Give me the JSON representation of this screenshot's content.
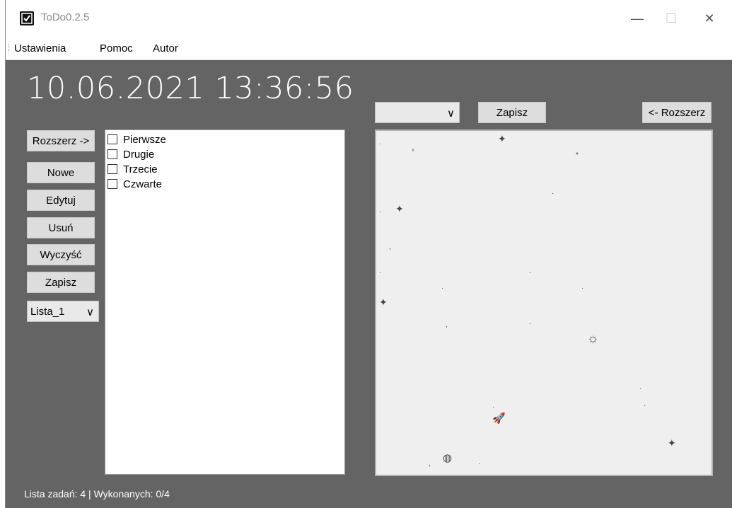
{
  "window": {
    "title": "ToDo0.2.5",
    "minimize_glyph": "—",
    "maximize_glyph": "☐",
    "close_glyph": "✕"
  },
  "menu": [
    "Ustawienia",
    "Pomoc",
    "Autor"
  ],
  "clock": "10.06.2021 13:36:56",
  "left_buttons": {
    "expand": "Rozszerz ->",
    "new": "Nowe",
    "edit": "Edytuj",
    "delete": "Usuń",
    "clear": "Wyczyść",
    "save": "Zapisz"
  },
  "list_select": {
    "value": "Lista_1",
    "arrow": "∨"
  },
  "tasks": [
    {
      "label": "Pierwsze",
      "done": false
    },
    {
      "label": "Drugie",
      "done": false
    },
    {
      "label": "Trzecie",
      "done": false
    },
    {
      "label": "Czwarte",
      "done": false
    }
  ],
  "right_panel": {
    "select_value": "",
    "select_arrow": "∨",
    "save_label": "Zapisz",
    "collapse_label": "<- Rozszerz"
  },
  "status": "Lista zadań: 4 | Wykonanych: 0/4",
  "colors": {
    "background": "#646464",
    "canvas": "#efefef",
    "button": "#dddddd"
  },
  "canvas_icons": [
    "star-sparkle",
    "sun",
    "rocket",
    "globe"
  ]
}
